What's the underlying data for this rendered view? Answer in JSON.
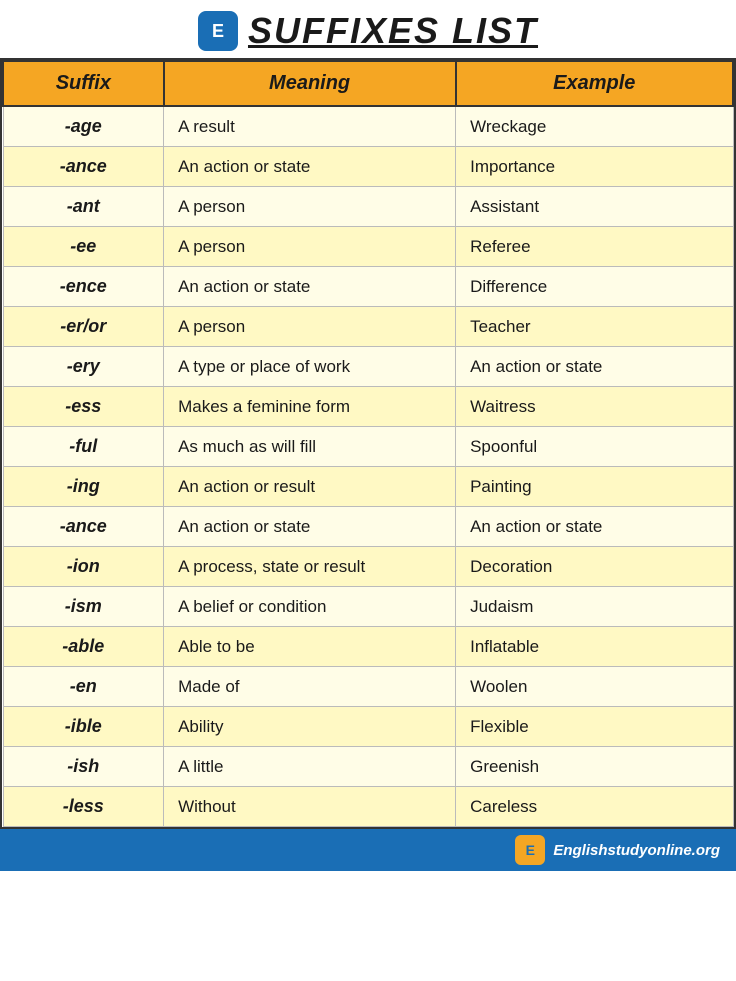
{
  "page": {
    "title": "SUFFIXES LIST",
    "logo_letter": "E",
    "footer_url": "Englishstudyonline.org"
  },
  "table": {
    "headers": [
      "Suffix",
      "Meaning",
      "Example"
    ],
    "rows": [
      {
        "suffix": "-age",
        "meaning": "A result",
        "example": "Wreckage"
      },
      {
        "suffix": "-ance",
        "meaning": "An action or state",
        "example": "Importance"
      },
      {
        "suffix": "-ant",
        "meaning": "A person",
        "example": "Assistant"
      },
      {
        "suffix": "-ee",
        "meaning": "A person",
        "example": "Referee"
      },
      {
        "suffix": "-ence",
        "meaning": "An action or state",
        "example": "Difference"
      },
      {
        "suffix": "-er/or",
        "meaning": "A person",
        "example": "Teacher"
      },
      {
        "suffix": "-ery",
        "meaning": "A type or place of work",
        "example": "An action or state"
      },
      {
        "suffix": "-ess",
        "meaning": "Makes a feminine form",
        "example": "Waitress"
      },
      {
        "suffix": "-ful",
        "meaning": "As much as will fill",
        "example": "Spoonful"
      },
      {
        "suffix": "-ing",
        "meaning": "An action or result",
        "example": "Painting"
      },
      {
        "suffix": "-ance",
        "meaning": "An action or state",
        "example": "An action or state"
      },
      {
        "suffix": "-ion",
        "meaning": "A process, state or result",
        "example": "Decoration"
      },
      {
        "suffix": "-ism",
        "meaning": "A belief or condition",
        "example": "Judaism"
      },
      {
        "suffix": "-able",
        "meaning": "Able to be",
        "example": "Inflatable"
      },
      {
        "suffix": "-en",
        "meaning": "Made of",
        "example": "Woolen"
      },
      {
        "suffix": "-ible",
        "meaning": "Ability",
        "example": "Flexible"
      },
      {
        "suffix": "-ish",
        "meaning": "A little",
        "example": "Greenish"
      },
      {
        "suffix": "-less",
        "meaning": "Without",
        "example": "Careless"
      }
    ]
  }
}
